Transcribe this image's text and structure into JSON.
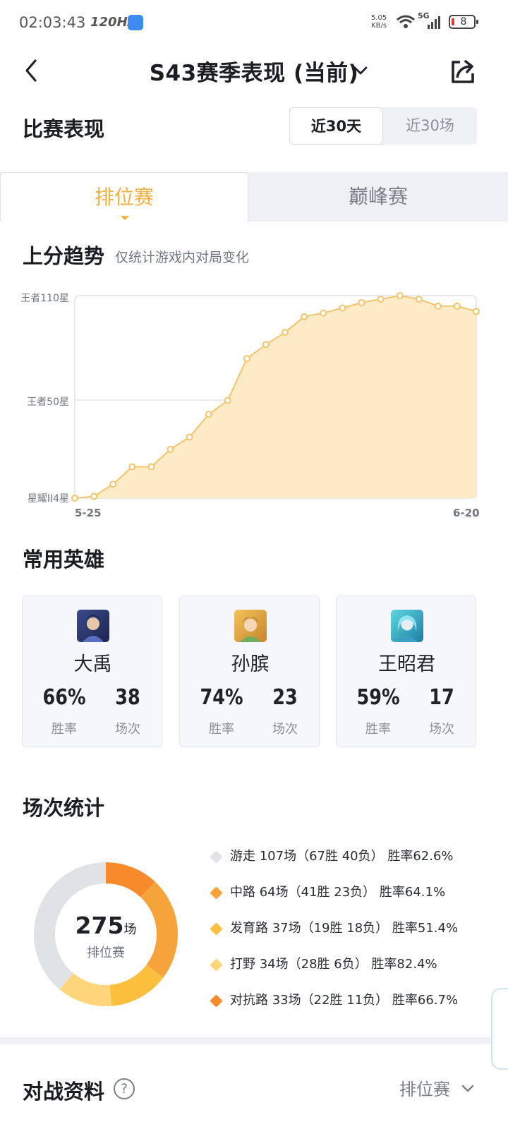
{
  "status_bar": {
    "time": "02:03:43",
    "refresh_rate": "120HZ",
    "net_speed_value": "5.05",
    "net_speed_unit": "KB/s",
    "network_type": "5G",
    "battery_level": "8"
  },
  "header": {
    "title": "S43赛季表现 (当前)",
    "back_icon": "chevron-left-icon",
    "share_icon": "share-icon"
  },
  "performance": {
    "heading": "比赛表现",
    "range_options": [
      "近30天",
      "近30场"
    ],
    "selected_range": "近30天"
  },
  "mode_tabs": {
    "items": [
      "排位赛",
      "巅峰赛"
    ],
    "active": "排位赛"
  },
  "trend": {
    "heading": "上分趋势",
    "note": "仅统计游戏内对局变化"
  },
  "chart_data": {
    "type": "area",
    "title": "上分趋势",
    "x_tick_labels": [
      "5-25",
      "6-20"
    ],
    "y_tick_labels": [
      "星耀II4星",
      "王者50星",
      "王者110星"
    ],
    "y_tick_values": [
      0,
      56,
      116
    ],
    "ylim": [
      0,
      116
    ],
    "grid": true,
    "color": "#f5c46a",
    "fill_color": "#fdebc8",
    "values": [
      0,
      1,
      8,
      18,
      18,
      28,
      35,
      48,
      56,
      80,
      88,
      95,
      104,
      106,
      109,
      112,
      114,
      116,
      114,
      110,
      110,
      107
    ]
  },
  "heroes": {
    "heading": "常用英雄",
    "win_rate_label": "胜率",
    "games_label": "场次",
    "items": [
      {
        "name": "大禹",
        "win_rate": "66%",
        "games": "38"
      },
      {
        "name": "孙膑",
        "win_rate": "74%",
        "games": "23"
      },
      {
        "name": "王昭君",
        "win_rate": "59%",
        "games": "17"
      }
    ]
  },
  "match_stats": {
    "heading": "场次统计",
    "total": "275",
    "total_unit": "场",
    "mode_label": "排位赛",
    "roles": [
      {
        "label": "游走 107场（67胜 40负） 胜率62.6%",
        "games": 107,
        "color": "#dfe3e6"
      },
      {
        "label": "中路 64场（41胜 23负） 胜率64.1%",
        "games": 64,
        "color": "#f7a33c"
      },
      {
        "label": "发育路 37场（19胜 18负） 胜率51.4%",
        "games": 37,
        "color": "#fbbe3d"
      },
      {
        "label": "打野 34场（28胜 6负） 胜率82.4%",
        "games": 34,
        "color": "#fdd57a"
      },
      {
        "label": "对抗路 33场（22胜 11负） 胜率66.7%",
        "games": 33,
        "color": "#f78a2a"
      }
    ]
  },
  "battle_data": {
    "heading": "对战资料",
    "mode_select": "排位赛"
  }
}
